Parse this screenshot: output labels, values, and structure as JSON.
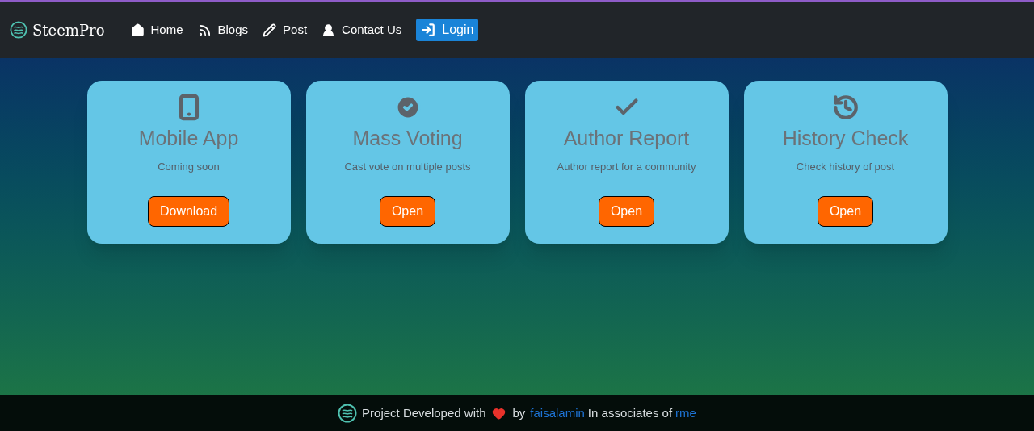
{
  "brand": "SteemPro",
  "nav": [
    {
      "kind": "home",
      "label": "Home"
    },
    {
      "kind": "blogs",
      "label": "Blogs"
    },
    {
      "kind": "post",
      "label": "Post"
    },
    {
      "kind": "contact",
      "label": "Contact Us"
    }
  ],
  "login": "Login",
  "cards": [
    {
      "kind": "phone",
      "title": "Mobile App",
      "text": "Coming soon",
      "button": "Download"
    },
    {
      "kind": "check-circle",
      "title": "Mass Voting",
      "text": "Cast vote on multiple posts",
      "button": "Open"
    },
    {
      "kind": "check",
      "title": "Author Report",
      "text": "Author report for a community",
      "button": "Open"
    },
    {
      "kind": "history",
      "title": "History Check",
      "text": "Check history of post",
      "button": "Open"
    }
  ],
  "footer": {
    "before": "Project Developed with",
    "by": "by",
    "author": "faisalamin",
    "middle": "In associates of",
    "partner": "rme"
  }
}
